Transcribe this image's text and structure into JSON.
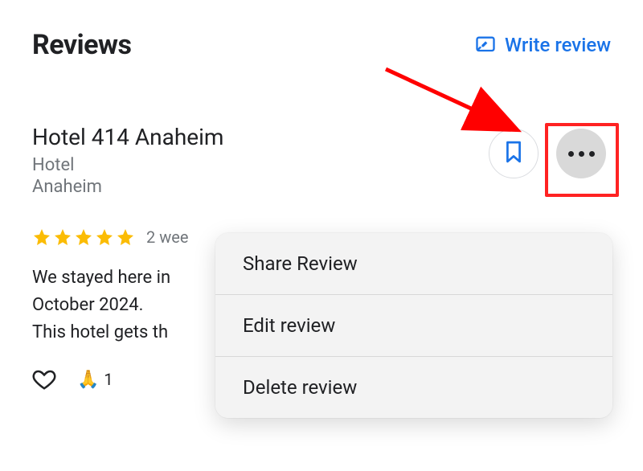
{
  "header": {
    "title": "Reviews",
    "write_review_label": "Write review"
  },
  "review": {
    "hotel_name": "Hotel 414 Anaheim",
    "hotel_type": "Hotel",
    "hotel_city": "Anaheim",
    "star_rating": 5,
    "age_text": "2 wee",
    "body_line1": "We stayed here in",
    "body_line2": "October 2024.",
    "body_line3": "This hotel gets th",
    "reactions": {
      "pray_emoji": "🙏",
      "pray_count": "1"
    }
  },
  "menu": {
    "items": [
      {
        "label": "Share Review"
      },
      {
        "label": "Edit review"
      },
      {
        "label": "Delete review"
      }
    ]
  },
  "annotation": {
    "highlight_target": "more-options-button",
    "arrow_color": "#ff0000"
  }
}
